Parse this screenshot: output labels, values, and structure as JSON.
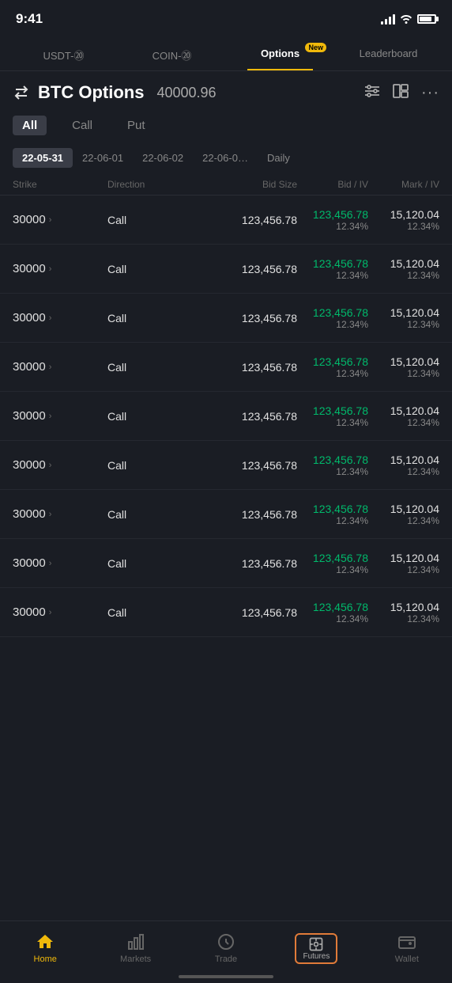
{
  "statusBar": {
    "time": "9:41",
    "battery": 85
  },
  "tabs": [
    {
      "id": "usdt",
      "label": "USDT-⑳",
      "active": false
    },
    {
      "id": "coin",
      "label": "COIN-⑳",
      "active": false
    },
    {
      "id": "options",
      "label": "Options",
      "active": true,
      "badge": "New"
    },
    {
      "id": "leaderboard",
      "label": "Leaderboard",
      "active": false
    }
  ],
  "header": {
    "title": "BTC Options",
    "price": "40000.96"
  },
  "filters": [
    {
      "id": "all",
      "label": "All",
      "active": true
    },
    {
      "id": "call",
      "label": "Call",
      "active": false
    },
    {
      "id": "put",
      "label": "Put",
      "active": false
    }
  ],
  "dates": [
    {
      "id": "d1",
      "label": "22-05-31",
      "active": true
    },
    {
      "id": "d2",
      "label": "22-06-01",
      "active": false
    },
    {
      "id": "d3",
      "label": "22-06-02",
      "active": false
    },
    {
      "id": "d4",
      "label": "22-06-0…",
      "active": false
    },
    {
      "id": "daily",
      "label": "Daily",
      "active": false
    }
  ],
  "tableHeaders": [
    "Strike",
    "Direction",
    "Bid Size",
    "Bid / IV",
    "Mark / IV"
  ],
  "rows": [
    {
      "strike": "30000",
      "direction": "Call",
      "bidSize": "123,456.78",
      "bidPrice": "123,456.78",
      "bidPct": "12.34%",
      "markPrice": "15,120.04",
      "markPct": "12.34%"
    },
    {
      "strike": "30000",
      "direction": "Call",
      "bidSize": "123,456.78",
      "bidPrice": "123,456.78",
      "bidPct": "12.34%",
      "markPrice": "15,120.04",
      "markPct": "12.34%"
    },
    {
      "strike": "30000",
      "direction": "Call",
      "bidSize": "123,456.78",
      "bidPrice": "123,456.78",
      "bidPct": "12.34%",
      "markPrice": "15,120.04",
      "markPct": "12.34%"
    },
    {
      "strike": "30000",
      "direction": "Call",
      "bidSize": "123,456.78",
      "bidPrice": "123,456.78",
      "bidPct": "12.34%",
      "markPrice": "15,120.04",
      "markPct": "12.34%"
    },
    {
      "strike": "30000",
      "direction": "Call",
      "bidSize": "123,456.78",
      "bidPrice": "123,456.78",
      "bidPct": "12.34%",
      "markPrice": "15,120.04",
      "markPct": "12.34%"
    },
    {
      "strike": "30000",
      "direction": "Call",
      "bidSize": "123,456.78",
      "bidPrice": "123,456.78",
      "bidPct": "12.34%",
      "markPrice": "15,120.04",
      "markPct": "12.34%"
    },
    {
      "strike": "30000",
      "direction": "Call",
      "bidSize": "123,456.78",
      "bidPrice": "123,456.78",
      "bidPct": "12.34%",
      "markPrice": "15,120.04",
      "markPct": "12.34%"
    },
    {
      "strike": "30000",
      "direction": "Call",
      "bidSize": "123,456.78",
      "bidPrice": "123,456.78",
      "bidPct": "12.34%",
      "markPrice": "15,120.04",
      "markPct": "12.34%"
    },
    {
      "strike": "30000",
      "direction": "Call",
      "bidSize": "123,456.78",
      "bidPrice": "123,456.78",
      "bidPct": "12.34%",
      "markPrice": "15,120.04",
      "markPct": "12.34%"
    }
  ],
  "bottomNav": [
    {
      "id": "home",
      "label": "Home",
      "active": true,
      "icon": "🏠"
    },
    {
      "id": "markets",
      "label": "Markets",
      "active": false,
      "icon": "📊"
    },
    {
      "id": "trade",
      "label": "Trade",
      "active": false,
      "icon": "🔄"
    },
    {
      "id": "futures",
      "label": "Futures",
      "active": false,
      "icon": "📋"
    },
    {
      "id": "wallet",
      "label": "Wallet",
      "active": false,
      "icon": "👛"
    }
  ]
}
